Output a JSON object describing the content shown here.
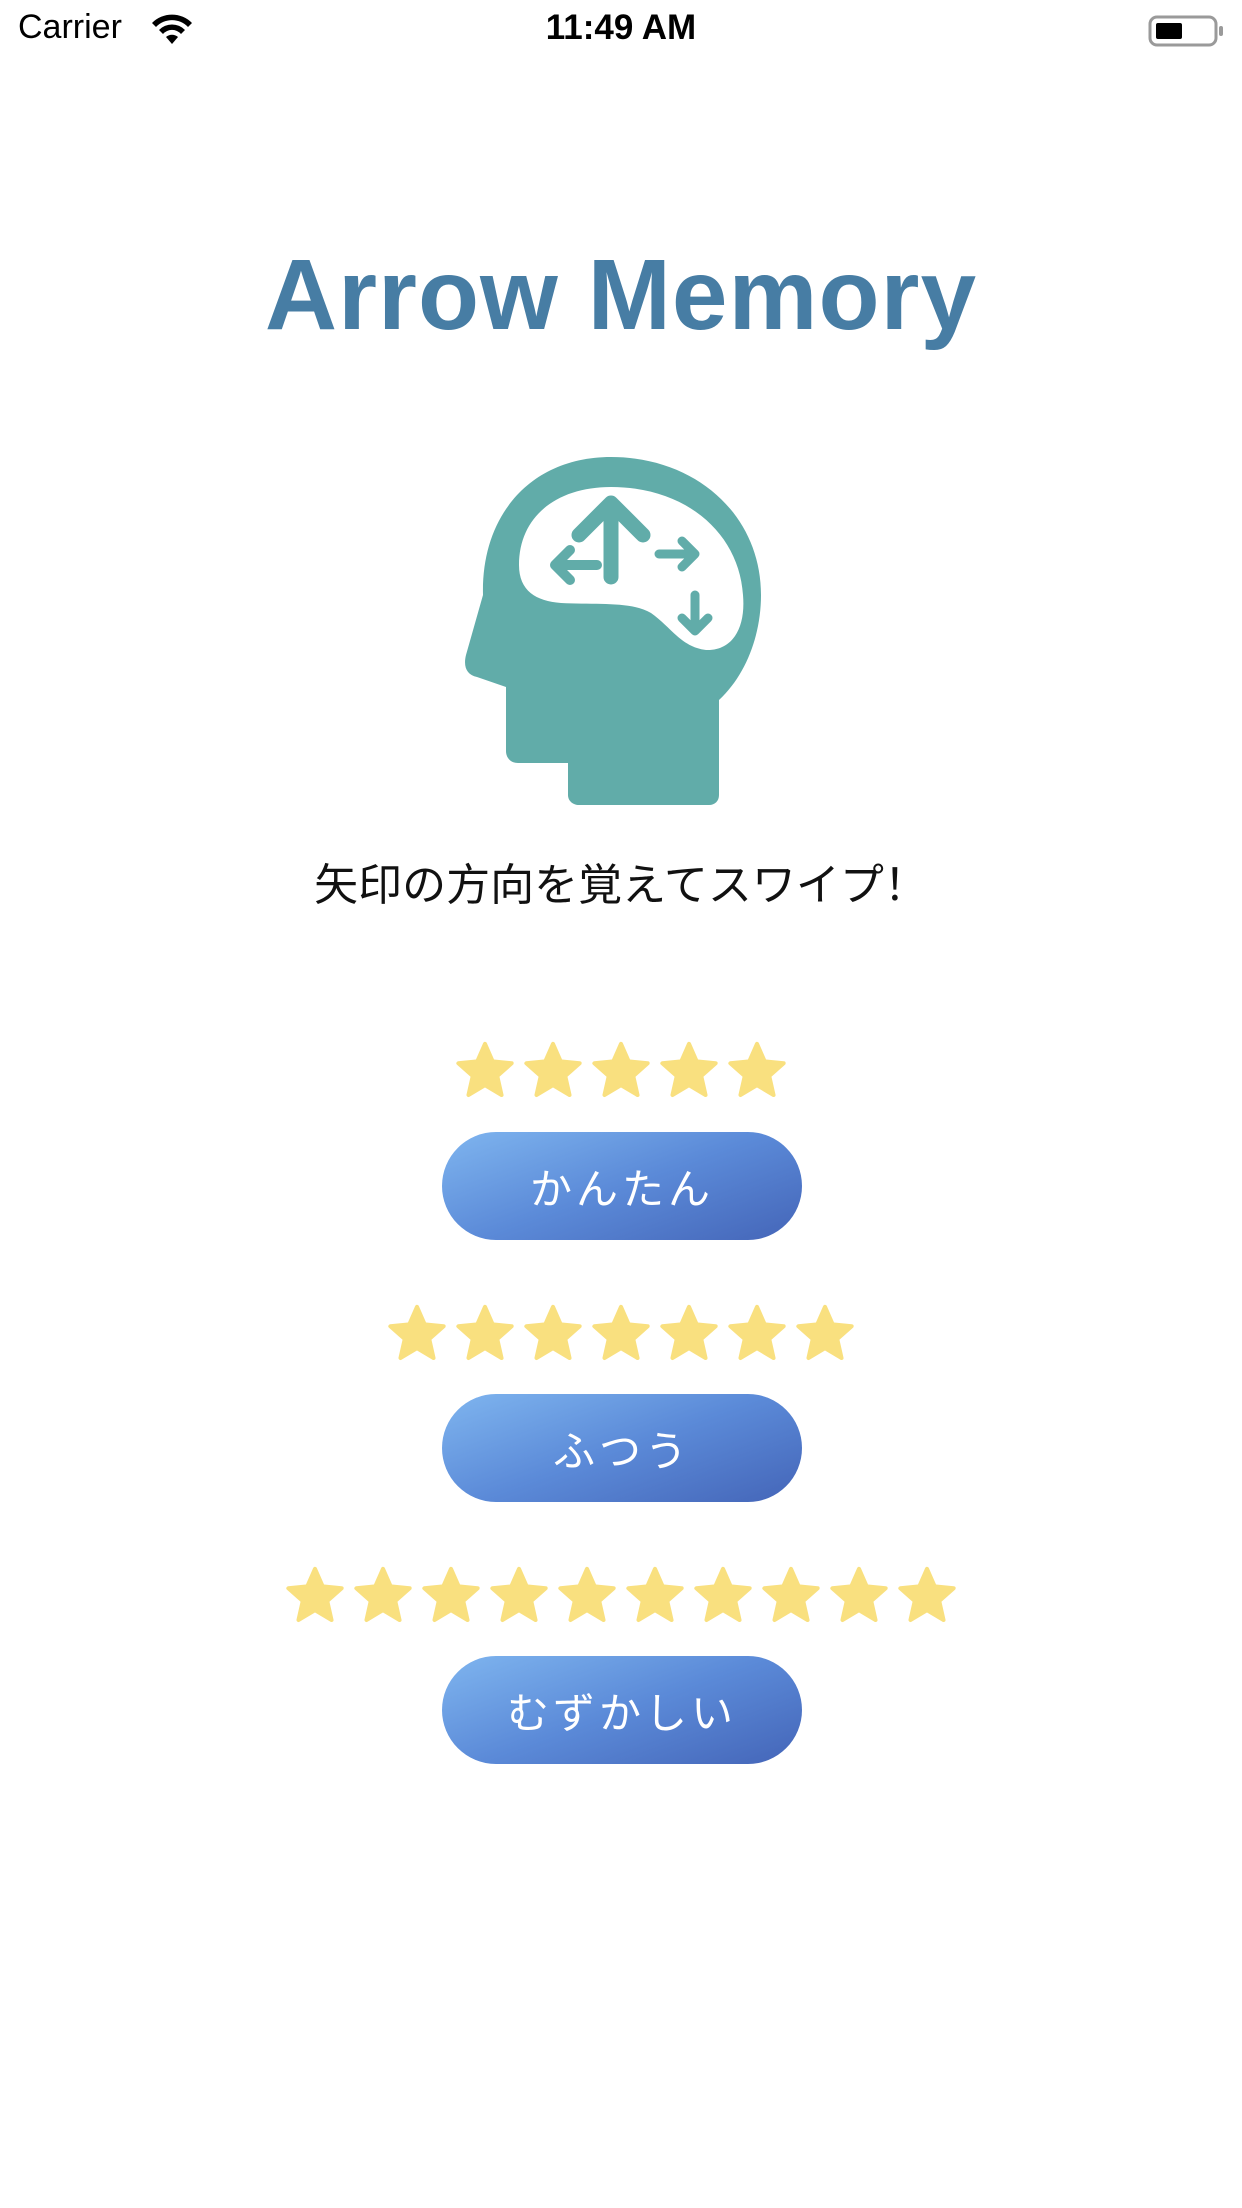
{
  "status_bar": {
    "carrier": "Carrier",
    "time": "11:49 AM",
    "icons": [
      "wifi-icon",
      "battery-icon"
    ]
  },
  "app": {
    "title": "Arrow Memory",
    "title_color": "#477da4",
    "logo_icon": "head-brain-arrows-icon",
    "logo_color": "#61aca9",
    "tagline": "矢印の方向を覚えてスワイプ！"
  },
  "levels": [
    {
      "label": "かんたん",
      "stars": 5
    },
    {
      "label": "ふつう",
      "stars": 7
    },
    {
      "label": "むずかしい",
      "stars": 10
    }
  ],
  "colors": {
    "star": "#f9e07f",
    "button_gradient_start": "#7fb5ef",
    "button_gradient_end": "#4465b8",
    "button_text": "#ffffff"
  }
}
